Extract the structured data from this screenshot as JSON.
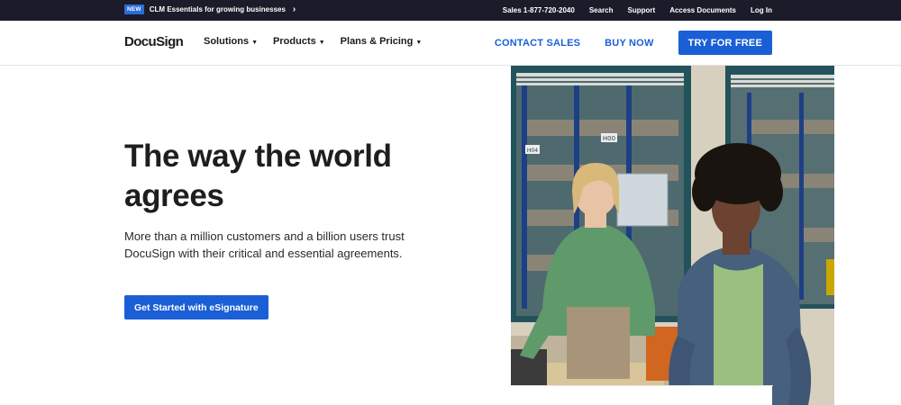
{
  "topbar": {
    "badge": "NEW",
    "announcement": "CLM Essentials for growing businesses",
    "chevron": "›",
    "links": [
      "Sales 1-877-720-2040",
      "Search",
      "Support",
      "Access Documents",
      "Log In"
    ]
  },
  "nav": {
    "logo": "DocuSign",
    "menu": [
      {
        "label": "Solutions"
      },
      {
        "label": "Products"
      },
      {
        "label": "Plans & Pricing"
      }
    ],
    "contact_sales": "CONTACT SALES",
    "buy_now": "BUY NOW",
    "try_free": "TRY FOR FREE"
  },
  "hero": {
    "headline": "The way the world agrees",
    "subtext": "More than a million customers and a billion users trust DocuSign with their critical and essential agreements.",
    "cta": "Get Started with eSignature",
    "image_sign_labels": [
      "H00",
      "H04"
    ]
  },
  "colors": {
    "brand_blue": "#1a5fd6",
    "topbar_bg": "#1b1b29",
    "badge_blue": "#2a6dd8"
  }
}
